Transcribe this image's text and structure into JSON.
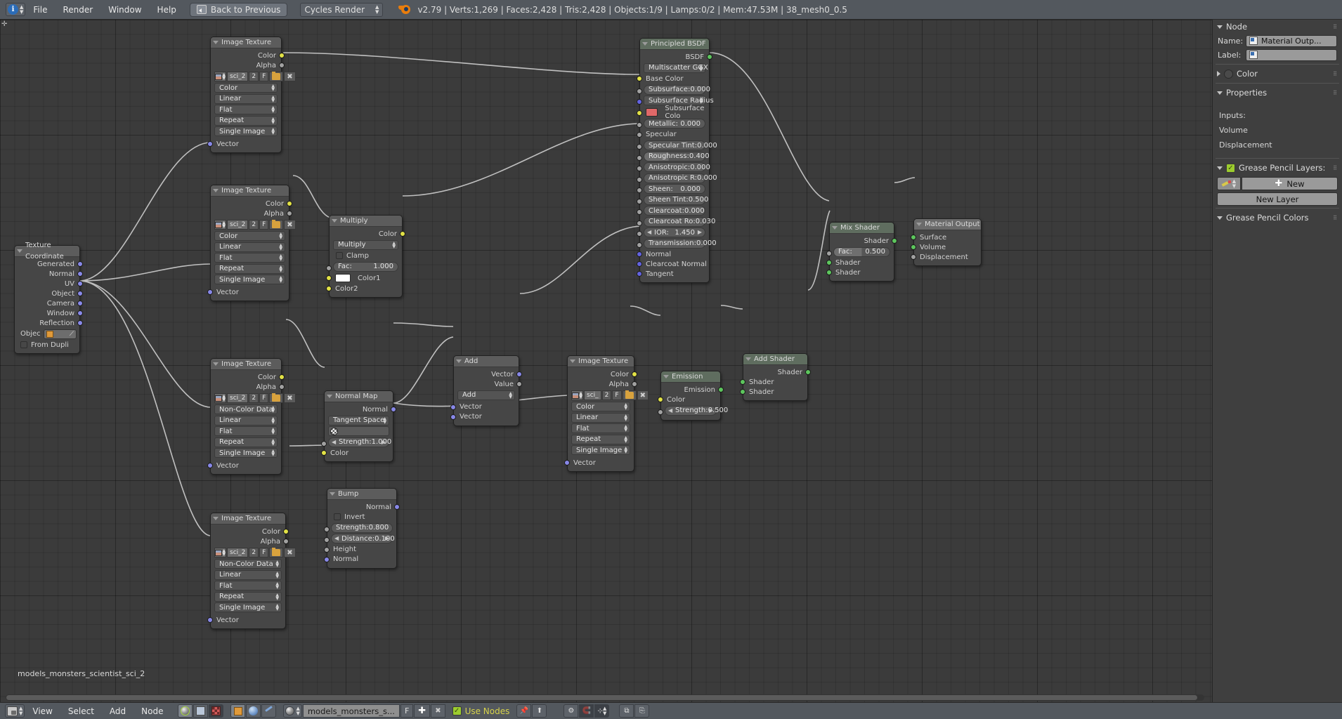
{
  "topbar": {
    "editor_icon": "info-icon",
    "menus": [
      "File",
      "Render",
      "Window",
      "Help"
    ],
    "back_button": "Back to Previous",
    "engine": "Cycles Render",
    "logo": "blender-logo",
    "stats": "v2.79 | Verts:1,269 | Faces:2,428 | Tris:2,428 | Objects:1/9 | Lamps:0/2 | Mem:47.53M | 38_mesh0_0.5"
  },
  "canvas": {
    "tree_name": "models_monsters_scientist_sci_2"
  },
  "nodes": {
    "img_tex_1": {
      "title": "Image Texture",
      "outputs": [
        "Color",
        "Alpha"
      ],
      "datablock": {
        "name": "sci_2",
        "users": "2",
        "fake_user": "F"
      },
      "dropdowns": [
        "Color",
        "Linear",
        "Flat",
        "Repeat",
        "Single Image"
      ],
      "inputs": [
        "Vector"
      ]
    },
    "img_tex_2": {
      "title": "Image Texture",
      "outputs": [
        "Color",
        "Alpha"
      ],
      "datablock": {
        "name": "sci_2",
        "users": "2",
        "fake_user": "F"
      },
      "dropdowns": [
        "Color",
        "Linear",
        "Flat",
        "Repeat",
        "Single Image"
      ],
      "inputs": [
        "Vector"
      ]
    },
    "img_tex_3": {
      "title": "Image Texture",
      "outputs": [
        "Color",
        "Alpha"
      ],
      "datablock": {
        "name": "sci_2",
        "users": "2",
        "fake_user": "F"
      },
      "dropdowns": [
        "Non-Color Data",
        "Linear",
        "Flat",
        "Repeat",
        "Single Image"
      ],
      "inputs": [
        "Vector"
      ]
    },
    "img_tex_4": {
      "title": "Image Texture",
      "outputs": [
        "Color",
        "Alpha"
      ],
      "datablock": {
        "name": "sci_2",
        "users": "2",
        "fake_user": "F"
      },
      "dropdowns": [
        "Non-Color Data",
        "Linear",
        "Flat",
        "Repeat",
        "Single Image"
      ],
      "inputs": [
        "Vector"
      ]
    },
    "img_tex_5": {
      "title": "Image Texture",
      "outputs": [
        "Color",
        "Alpha"
      ],
      "datablock": {
        "name": "sci_",
        "users": "2",
        "fake_user": "F"
      },
      "dropdowns": [
        "Color",
        "Linear",
        "Flat",
        "Repeat",
        "Single Image"
      ],
      "inputs": [
        "Vector"
      ]
    },
    "texture_coordinate": {
      "title": "Texture Coordinate",
      "outputs": [
        "Generated",
        "Normal",
        "UV",
        "Object",
        "Camera",
        "Window",
        "Reflection"
      ],
      "object_label": "Objec",
      "from_dupli": "From Dupli"
    },
    "multiply": {
      "title": "Multiply",
      "outputs": [
        "Color"
      ],
      "blend_mode": "Multiply",
      "clamp": "Clamp",
      "fac_label": "Fac:",
      "fac_value": "1.000",
      "color1": "Color1",
      "color2": "Color2",
      "color1_swatch": "#ffffff"
    },
    "normal_map": {
      "title": "Normal Map",
      "outputs": [
        "Normal"
      ],
      "space": "Tangent Space",
      "uv_map": "",
      "strength_label": "Strength:",
      "strength_value": "1.000",
      "inputs": [
        "Color"
      ]
    },
    "bump": {
      "title": "Bump",
      "outputs": [
        "Normal"
      ],
      "invert": "Invert",
      "strength_label": "Strength:",
      "strength_value": "0.800",
      "distance_label": "Distance:",
      "distance_value": "0.100",
      "inputs": [
        "Height",
        "Normal"
      ]
    },
    "vector_add": {
      "title": "Add",
      "outputs": [
        "Vector",
        "Value"
      ],
      "operation": "Add",
      "inputs": [
        "Vector",
        "Vector"
      ]
    },
    "principled": {
      "title": "Principled BSDF",
      "output": "BSDF",
      "distribution": "Multiscatter GGX",
      "params": [
        {
          "label": "Base Color",
          "value": "",
          "type": "socket_label",
          "color": "yellow"
        },
        {
          "label": "Subsurface:",
          "value": "0.000",
          "type": "slider",
          "color": "grey"
        },
        {
          "label": "Subsurface Radius",
          "value": "",
          "type": "dropdown",
          "color": "blue"
        },
        {
          "label": "Subsurface Colo",
          "value": "",
          "type": "swatch",
          "color": "yellow",
          "swatch": "#e06868"
        },
        {
          "label": "Metallic:",
          "value": "0.000",
          "type": "slider",
          "color": "grey"
        },
        {
          "label": "Specular",
          "value": "",
          "type": "socket_label",
          "color": "grey"
        },
        {
          "label": "Specular Tint:",
          "value": "0.000",
          "type": "slider",
          "color": "grey"
        },
        {
          "label": "Roughness:",
          "value": "0.400",
          "type": "slider",
          "color": "grey"
        },
        {
          "label": "Anisotropic:",
          "value": "0.000",
          "type": "slider",
          "color": "grey"
        },
        {
          "label": "Anisotropic R:",
          "value": "0.000",
          "type": "slider",
          "color": "grey"
        },
        {
          "label": "Sheen:",
          "value": "0.000",
          "type": "slider",
          "color": "grey"
        },
        {
          "label": "Sheen Tint:",
          "value": "0.500",
          "type": "slider",
          "color": "grey"
        },
        {
          "label": "Clearcoat:",
          "value": "0.000",
          "type": "slider",
          "color": "grey"
        },
        {
          "label": "Clearcoat Ro:",
          "value": "0.030",
          "type": "slider",
          "color": "grey"
        },
        {
          "label": "IOR:",
          "value": "1.450",
          "type": "number",
          "color": "grey"
        },
        {
          "label": "Transmission:",
          "value": "0.000",
          "type": "slider",
          "color": "grey"
        },
        {
          "label": "Normal",
          "value": "",
          "type": "socket_label",
          "color": "blue"
        },
        {
          "label": "Clearcoat Normal",
          "value": "",
          "type": "socket_label",
          "color": "blue"
        },
        {
          "label": "Tangent",
          "value": "",
          "type": "socket_label",
          "color": "blue"
        }
      ]
    },
    "emission": {
      "title": "Emission",
      "outputs": [
        "Emission"
      ],
      "inputs": [
        "Color"
      ],
      "strength_label": "Strength:",
      "strength_value": "0.500"
    },
    "add_shader": {
      "title": "Add Shader",
      "outputs": [
        "Shader"
      ],
      "inputs": [
        "Shader",
        "Shader"
      ]
    },
    "mix_shader": {
      "title": "Mix Shader",
      "outputs": [
        "Shader"
      ],
      "fac_label": "Fac:",
      "fac_value": "0.500",
      "inputs": [
        "Shader",
        "Shader"
      ]
    },
    "material_output": {
      "title": "Material Output",
      "inputs": [
        "Surface",
        "Volume",
        "Displacement"
      ]
    }
  },
  "properties": {
    "node_panel": {
      "title": "Node",
      "name_label": "Name:",
      "name_value": "Material Outp...",
      "label_label": "Label:",
      "label_value": ""
    },
    "color_panel": {
      "title": "Color"
    },
    "properties_panel": {
      "title": "Properties",
      "lines": [
        "Inputs:",
        "Volume",
        "Displacement"
      ]
    },
    "grease_pencil_layers": {
      "title": "Grease Pencil Layers:",
      "new_button": "New",
      "new_layer_button": "New Layer"
    },
    "grease_pencil_colors": {
      "title": "Grease Pencil Colors"
    }
  },
  "bottombar": {
    "editor_icon": "node-editor-icon",
    "menus": [
      "View",
      "Select",
      "Add",
      "Node"
    ],
    "shader_type_icons": [
      "material-ball-icon",
      "world-icon",
      "line-style-icon"
    ],
    "context_icons": [
      "object-icon",
      "world-icon",
      "brush-icon"
    ],
    "material_name": "models_monsters_s...",
    "fake_user": "F",
    "use_nodes": "Use Nodes",
    "tool_icons": [
      "pin-icon",
      "go-to-parent-icon",
      "node-group-icon",
      "snap-magnet-icon",
      "snap-target-icon",
      "copy-icon",
      "paste-icon"
    ]
  }
}
